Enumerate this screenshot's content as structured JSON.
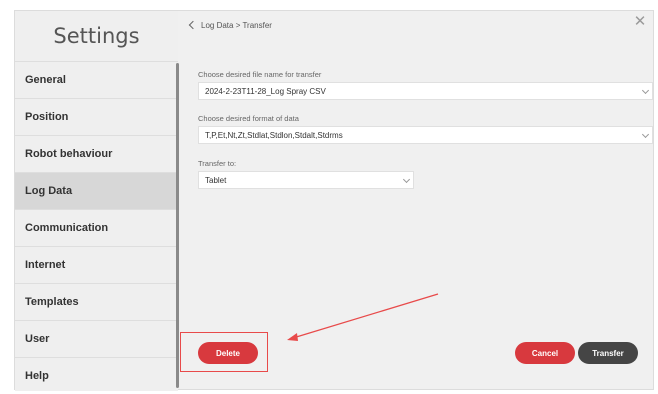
{
  "sidebar": {
    "title": "Settings",
    "items": [
      {
        "label": "General",
        "active": false
      },
      {
        "label": "Position",
        "active": false
      },
      {
        "label": "Robot behaviour",
        "active": false
      },
      {
        "label": "Log Data",
        "active": true
      },
      {
        "label": "Communication",
        "active": false
      },
      {
        "label": "Internet",
        "active": false
      },
      {
        "label": "Templates",
        "active": false
      },
      {
        "label": "User",
        "active": false
      },
      {
        "label": "Help",
        "active": false
      }
    ]
  },
  "header": {
    "breadcrumb": "Log Data > Transfer"
  },
  "form": {
    "file_name_label": "Choose desired file name for transfer",
    "file_name_value": "2024-2-23T11-28_Log Spray CSV",
    "format_label": "Choose desired format of data",
    "format_value": "T,P,Et,Nt,Zt,Stdlat,Stdlon,Stdalt,Stdrms",
    "transfer_to_label": "Transfer to:",
    "transfer_to_value": "Tablet"
  },
  "actions": {
    "delete_label": "Delete",
    "cancel_label": "Cancel",
    "transfer_label": "Transfer"
  },
  "colors": {
    "accent_red": "#d8393e",
    "dark_button": "#454545",
    "annotation": "#e84a4a"
  }
}
